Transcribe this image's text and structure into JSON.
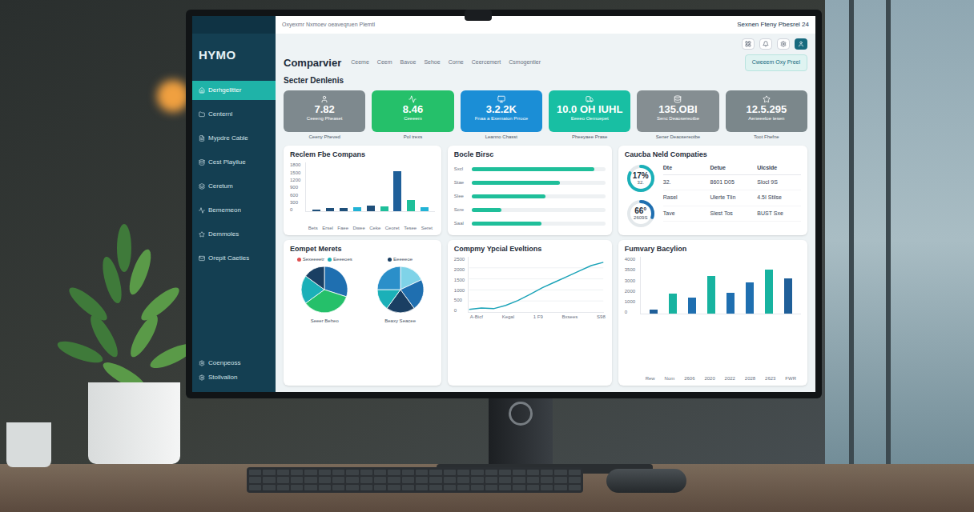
{
  "screen": {
    "topbar": {
      "path": "Oxyexmr Nxmoev oeaveqruen Plemtl",
      "user": "Sexnen Fteny Pbesrel 24"
    },
    "sidebar": {
      "logo": "HYMO",
      "items": [
        {
          "label": "Derhgelltter",
          "selected": true
        },
        {
          "label": "Centernl",
          "selected": false
        },
        {
          "label": "Mypdre Cable",
          "selected": false
        },
        {
          "label": "Cest Playilue",
          "selected": false
        },
        {
          "label": "Ceretum",
          "selected": false
        },
        {
          "label": "Bememeon",
          "selected": false
        },
        {
          "label": "Demmoles",
          "selected": false
        },
        {
          "label": "Orepit Caeties",
          "selected": false
        }
      ],
      "footer": [
        "Coenpeoss",
        "Stoilvalion"
      ]
    },
    "header": {
      "title": "Comparvier",
      "tabs": [
        {
          "label": "Ceeme",
          "selected": false
        },
        {
          "label": "Ceem",
          "selected": false
        },
        {
          "label": "Bavoe",
          "selected": false
        },
        {
          "label": "Sehoe",
          "selected": false
        },
        {
          "label": "Corne",
          "selected": false
        },
        {
          "label": "Ceercemert",
          "selected": false
        },
        {
          "label": "Csmogentier",
          "selected": false
        }
      ],
      "button": "Cweeem Oxy Preel"
    },
    "section_title": "Secter Denlenis",
    "kpis": [
      {
        "value": "7.82",
        "caption": "Ceeeng Pheaset",
        "label": "Ceeny Pheved",
        "color": "#7e898e"
      },
      {
        "value": "8.46",
        "caption": "Ceeeem",
        "label": "Pol trexs",
        "color": "#25c06a"
      },
      {
        "value": "3.2.2K",
        "caption": "Fnaa a Exemaion Prroce",
        "label": "Leanno Chasst",
        "color": "#1b8ed6"
      },
      {
        "value": "10.0 OH IUHL",
        "caption": "Eeeeo Oemuepet",
        "label": "Pheeyaee Prase",
        "color": "#18bfa3"
      },
      {
        "value": "135.OBI",
        "caption": "Senc Deaosereotbe",
        "label": "Sener Deaosereotbe",
        "color": "#858e92"
      },
      {
        "value": "12.5.295",
        "caption": "Aeneeeloe tesen",
        "label": "Toot Fhefne",
        "color": "#7b878b"
      }
    ],
    "bar_chart": {
      "title": "Reclem Fbe Compans",
      "ticks": [
        "1800",
        "1500",
        "1200",
        "900",
        "600",
        "300",
        "0"
      ],
      "max": 1800,
      "bars": [
        {
          "value": 80,
          "color": "#1f4f7a"
        },
        {
          "value": 120,
          "color": "#1f4f7a"
        },
        {
          "value": 110,
          "color": "#1f4f7a"
        },
        {
          "value": 160,
          "color": "#22b3d6"
        },
        {
          "value": 200,
          "color": "#1f4f7a"
        },
        {
          "value": 190,
          "color": "#1fbf9a"
        },
        {
          "value": 1450,
          "color": "#1f5f99"
        },
        {
          "value": 420,
          "color": "#1fbf9a"
        },
        {
          "value": 140,
          "color": "#22b3d6"
        }
      ],
      "labels": [
        "Bets",
        "Ersel",
        "Faee",
        "Dwee",
        "Ceke",
        "Ceoret",
        "Tesee",
        "Seret"
      ]
    },
    "hbar_chart": {
      "title": "Bocle Birsc",
      "rows": [
        {
          "label": "Sxcl",
          "level": 0.92
        },
        {
          "label": "Stae",
          "level": 0.66
        },
        {
          "label": "Slee",
          "level": 0.55
        },
        {
          "label": "Scre",
          "level": 0.22
        },
        {
          "label": "Saal",
          "level": 0.52
        }
      ]
    },
    "donut_panel": {
      "title": "Caucba Neld Compaties",
      "donuts": [
        {
          "reading": "17%",
          "sub": "32.",
          "level": 0.82,
          "color": "#1bb0b8"
        },
        {
          "reading": "66°",
          "sub": "2609S",
          "level": 0.3,
          "color": "#1f6fb0"
        }
      ],
      "columns": [
        "Dte",
        "Detue",
        "Ulcslde"
      ],
      "rows": [
        [
          "32.",
          "8601 D05",
          "Slocl 9S"
        ],
        [
          "Rasel",
          "Ulerte Tlin",
          "4.5I Stilse"
        ],
        [
          "Tave",
          "Slest Tos",
          "BUST Sxe"
        ]
      ]
    },
    "pie_panel": {
      "title": "Eompet Merets",
      "pies": [
        {
          "legend": [
            {
              "label": "Sexeeeetr",
              "color": "#e05050"
            },
            {
              "label": "Eeeeoes",
              "color": "#1bb0b8"
            }
          ],
          "caption": "Seeer Beheo",
          "slices": [
            {
              "value": 30,
              "color": "#1f6fb0"
            },
            {
              "value": 35,
              "color": "#25c06a"
            },
            {
              "value": 20,
              "color": "#1bb0b8"
            },
            {
              "value": 15,
              "color": "#1a3f63"
            }
          ]
        },
        {
          "legend": [
            {
              "label": "Eeeeeoe",
              "color": "#1a3f63"
            }
          ],
          "caption": "Beaxy Seacee",
          "slices": [
            {
              "value": 18,
              "color": "#7fd3e8"
            },
            {
              "value": 22,
              "color": "#1f6fb0"
            },
            {
              "value": 20,
              "color": "#1a3f63"
            },
            {
              "value": 15,
              "color": "#1bb0b8"
            },
            {
              "value": 25,
              "color": "#2b8fc9"
            }
          ]
        }
      ]
    },
    "line_chart": {
      "title": "Compmy Ypcial Eveltions",
      "ticks": [
        "2500",
        "2000",
        "1500",
        "1000",
        "500",
        "0"
      ],
      "max": 2500,
      "values": [
        120,
        180,
        150,
        300,
        520,
        800,
        1100,
        1350,
        1600,
        1850,
        2100,
        2250
      ],
      "labels": [
        "A-Bicf",
        "Kegal",
        "1 F9",
        "Bxsees",
        "S98"
      ]
    },
    "column_chart": {
      "title": "Fumvary Bacylion",
      "ticks": [
        "4000",
        "3500",
        "3000",
        "2000",
        "1000",
        "0"
      ],
      "max": 4000,
      "bars": [
        {
          "value": 300,
          "color": "#1f5f99"
        },
        {
          "value": 1400,
          "color": "#17b3a0"
        },
        {
          "value": 1150,
          "color": "#1f6fb0"
        },
        {
          "value": 2600,
          "color": "#17b3a0"
        },
        {
          "value": 1450,
          "color": "#1f6fb0"
        },
        {
          "value": 2200,
          "color": "#1f6fb0"
        },
        {
          "value": 3050,
          "color": "#17b3a0"
        },
        {
          "value": 2450,
          "color": "#1f5f99"
        }
      ],
      "labels": [
        "Rew",
        "Nom",
        "2606",
        "2020",
        "2022",
        "2028",
        "2623",
        "FWR"
      ]
    }
  }
}
